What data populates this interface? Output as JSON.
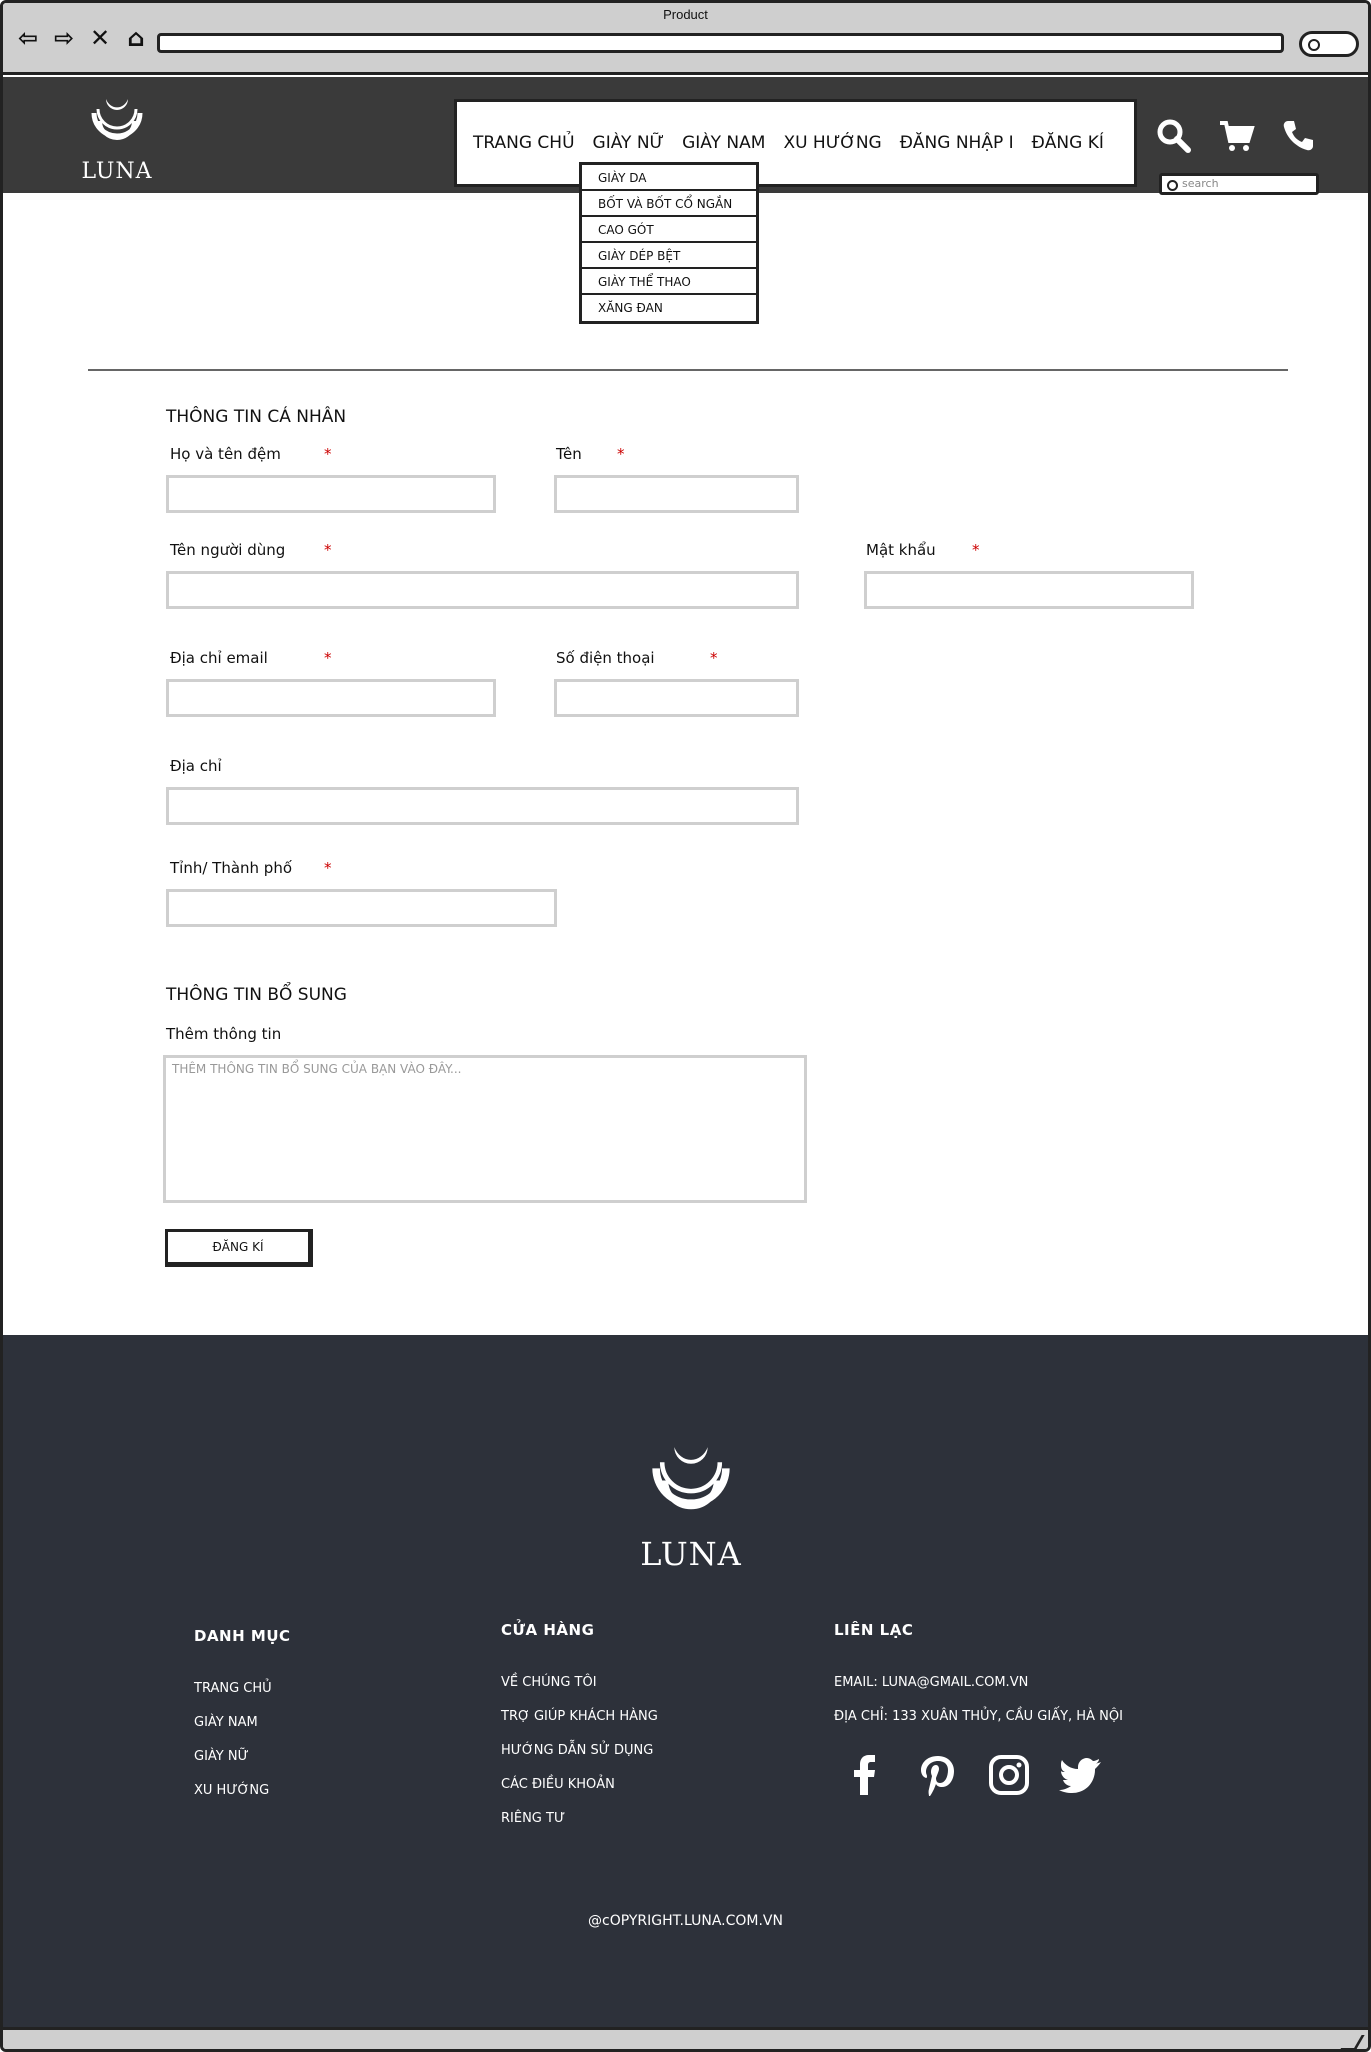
{
  "browser": {
    "title": "Product",
    "nav_back_icon": "arrow-left-icon",
    "nav_forward_icon": "arrow-right-icon",
    "nav_close_icon": "close-icon",
    "nav_home_icon": "home-icon"
  },
  "header": {
    "logo_text": "LUNA",
    "menu": [
      "TRANG CHỦ",
      "GIÀY NỮ",
      "GIÀY NAM",
      "XU HƯỚNG",
      "ĐĂNG NHẬP I",
      "ĐĂNG KÍ"
    ],
    "icons": [
      "search-icon",
      "cart-icon",
      "phone-icon"
    ],
    "search_placeholder": "search"
  },
  "dropdown": {
    "items": [
      "GIÀY DA",
      "BỐT VÀ BỐT CỔ NGẮN",
      "CAO GÓT",
      "GIÀY DÉP BỆT",
      "GIÀY THỂ THAO",
      "XĂNG ĐAN"
    ]
  },
  "form": {
    "personal_title": "THÔNG TIN CÁ NHÂN",
    "labels": {
      "last_middle_name": "Họ và tên đệm",
      "first_name": "Tên",
      "username": "Tên người dùng",
      "password": "Mật khẩu",
      "email": "Địa chỉ email",
      "phone": "Số điện thoại",
      "address": "Địa chỉ",
      "city": "Tỉnh/ Thành phố"
    },
    "required_mark": "*",
    "extra_title": "THÔNG TIN BỔ SUNG",
    "extra_label": "Thêm thông tin",
    "extra_placeholder": "THÊM THÔNG TIN BỔ SUNG CỦA BẠN VÀO ĐÂY...",
    "submit_label": "ĐĂNG KÍ"
  },
  "footer": {
    "logo_text": "LUNA",
    "columns": [
      {
        "heading": "DANH MỤC",
        "links": [
          "TRANG CHỦ",
          "GIÀY NAM",
          "GIÀY NỮ",
          "XU HƯỚNG"
        ]
      },
      {
        "heading": "CỬA HÀNG",
        "links": [
          "VỀ CHÚNG TÔI",
          "TRỢ GIÚP KHÁCH HÀNG",
          "HƯỚNG DẪN SỬ DỤNG",
          "CÁC ĐIỀU KHOẢN",
          "RIÊNG TƯ"
        ]
      },
      {
        "heading": "LIÊN LẠC",
        "links": [
          "EMAIL: LUNA@GMAIL.COM.VN",
          "ĐỊA CHỈ: 133 XUÂN THỦY, CẦU GIẤY, HÀ NỘI"
        ]
      }
    ],
    "social": [
      "facebook-icon",
      "pinterest-icon",
      "instagram-icon",
      "twitter-icon"
    ],
    "copyright": "@cOPYRIGHT.LUNA.COM.VN"
  },
  "colors": {
    "header_bg": "#3a3a3a",
    "footer_bg": "#2d313a",
    "required": "#cc0000"
  }
}
